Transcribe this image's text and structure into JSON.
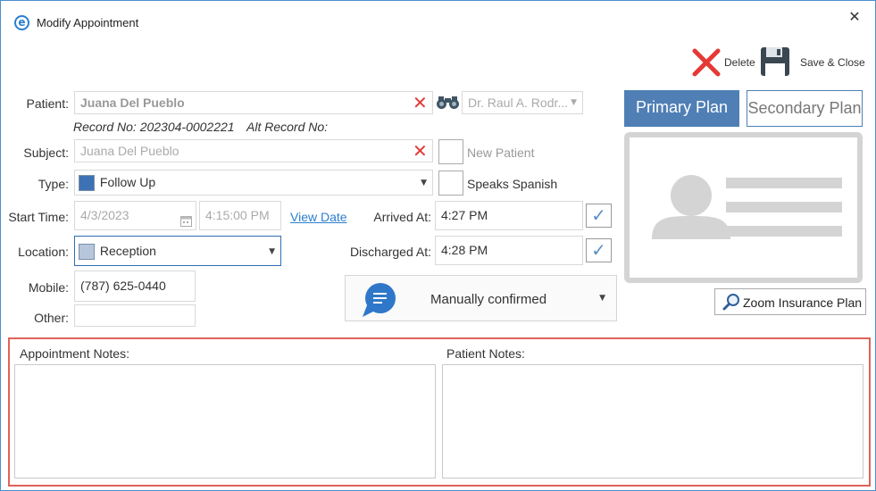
{
  "window": {
    "title": "Modify Appointment",
    "close_glyph": "✕"
  },
  "toolbar": {
    "delete_label": "Delete",
    "save_close_label": "Save & Close"
  },
  "patient": {
    "label": "Patient:",
    "value": "Juana Del Pueblo",
    "record_no": "Record No: 202304-0002221",
    "alt_record_no": "Alt Record No:",
    "clear_glyph": "✕"
  },
  "provider": {
    "value": "Dr. Raul A. Rodr..."
  },
  "subject": {
    "label": "Subject:",
    "value": "Juana Del Pueblo"
  },
  "type": {
    "label": "Type:",
    "value": "Follow Up",
    "color": "#3e72b5"
  },
  "new_patient": {
    "label": "New Patient",
    "checked": false
  },
  "speaks_spanish": {
    "label": "Speaks Spanish",
    "checked": false
  },
  "start_time": {
    "label": "Start Time:",
    "date": "4/3/2023",
    "time": "4:15:00 PM",
    "view_date_link": "View Date"
  },
  "arrived": {
    "label": "Arrived At:",
    "value": "4:27 PM"
  },
  "discharged": {
    "label": "Discharged At:",
    "value": "4:28 PM"
  },
  "location": {
    "label": "Location:",
    "value": "Reception",
    "color": "#b8c6dc"
  },
  "mobile": {
    "label": "Mobile:",
    "value": "(787) 625-0440"
  },
  "other": {
    "label": "Other:",
    "value": ""
  },
  "confirmation": {
    "value": "Manually confirmed"
  },
  "insurance": {
    "primary_label": "Primary Plan",
    "secondary_label": "Secondary Plan",
    "zoom_label": "Zoom Insurance Plan"
  },
  "notes": {
    "appointment_label": "Appointment Notes:",
    "patient_label": "Patient Notes:",
    "appointment_value": "",
    "patient_value": ""
  },
  "colors": {
    "accent": "#4f7fb5",
    "danger": "#e53935",
    "highlight_border": "#e0635a"
  },
  "icons": {
    "app": "app-logo-icon",
    "delete": "red-x-icon",
    "save": "floppy-disk-icon",
    "binoculars": "binoculars-icon",
    "calendar": "calendar-icon",
    "chat": "chat-bubble-icon",
    "zoom": "magnifier-icon",
    "id_card": "id-card-placeholder-icon"
  }
}
